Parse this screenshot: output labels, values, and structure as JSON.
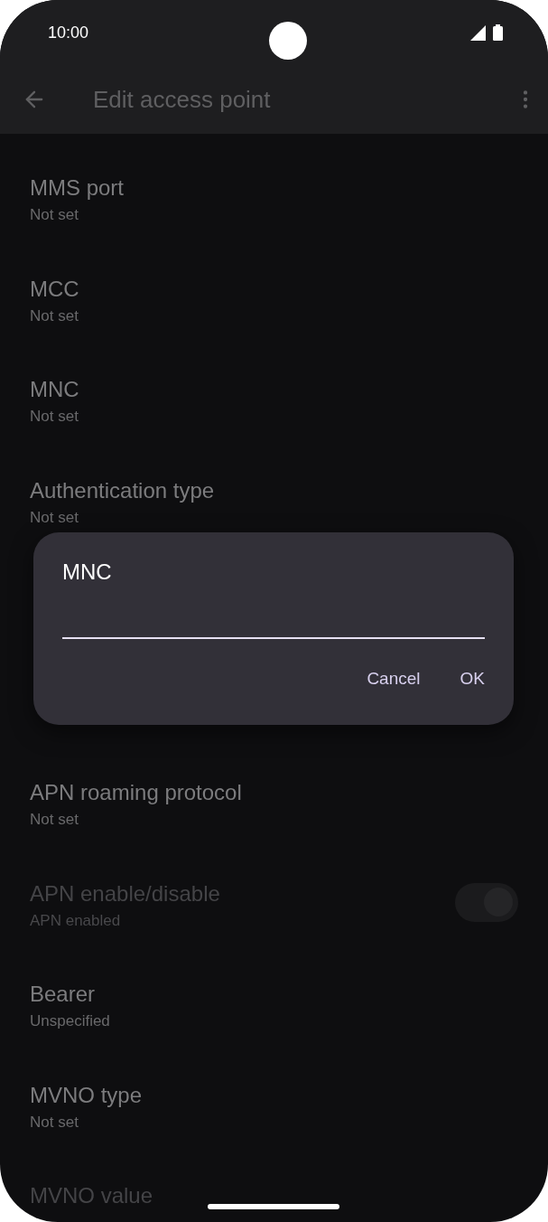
{
  "status_bar": {
    "time": "10:00"
  },
  "app_bar": {
    "title": "Edit access point"
  },
  "settings": [
    {
      "kind": "text",
      "title": "MMS port",
      "summary": "Not set",
      "disabled": false
    },
    {
      "kind": "text",
      "title": "MCC",
      "summary": "Not set",
      "disabled": false
    },
    {
      "kind": "text",
      "title": "MNC",
      "summary": "Not set",
      "disabled": false
    },
    {
      "kind": "text",
      "title": "Authentication type",
      "summary": "Not set",
      "disabled": false
    },
    {
      "kind": "hidden"
    },
    {
      "kind": "hidden"
    },
    {
      "kind": "text",
      "title": "APN roaming protocol",
      "summary": "Not set",
      "disabled": false
    },
    {
      "kind": "switch",
      "title": "APN enable/disable",
      "summary": "APN enabled",
      "disabled": true,
      "on": true
    },
    {
      "kind": "text",
      "title": "Bearer",
      "summary": "Unspecified",
      "disabled": false
    },
    {
      "kind": "text",
      "title": "MVNO type",
      "summary": "Not set",
      "disabled": false
    },
    {
      "kind": "text",
      "title": "MVNO value",
      "disabled": true
    }
  ],
  "dialog": {
    "title": "MNC",
    "buttons": [
      "Cancel",
      "OK"
    ]
  }
}
